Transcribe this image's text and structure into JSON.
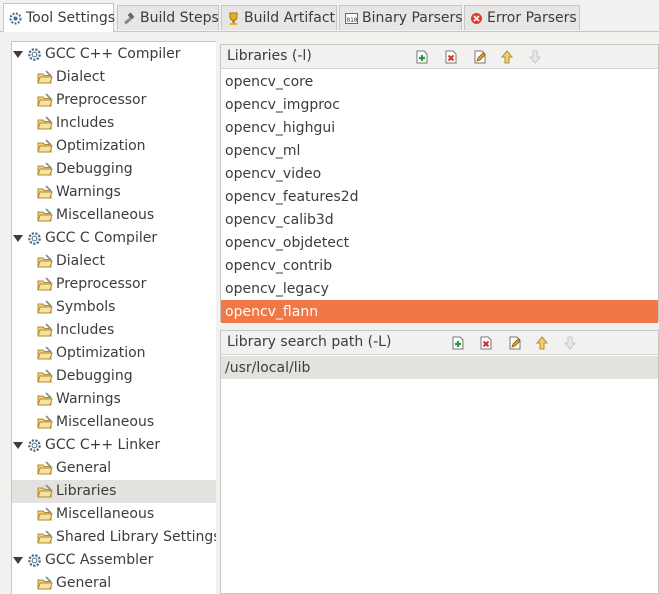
{
  "tabs": [
    {
      "label": "Tool Settings",
      "icon": "tool-settings-icon",
      "active": true
    },
    {
      "label": "Build Steps",
      "icon": "build-steps-icon",
      "active": false
    },
    {
      "label": "Build Artifact",
      "icon": "build-artifact-icon",
      "active": false
    },
    {
      "label": "Binary Parsers",
      "icon": "binary-parsers-icon",
      "active": false
    },
    {
      "label": "Error Parsers",
      "icon": "error-parsers-icon",
      "active": false
    }
  ],
  "tree": [
    {
      "label": "GCC C++ Compiler",
      "level": 0,
      "icon": "gear-icon"
    },
    {
      "label": "Dialect",
      "level": 1,
      "icon": "folder-icon"
    },
    {
      "label": "Preprocessor",
      "level": 1,
      "icon": "folder-icon"
    },
    {
      "label": "Includes",
      "level": 1,
      "icon": "folder-icon"
    },
    {
      "label": "Optimization",
      "level": 1,
      "icon": "folder-icon"
    },
    {
      "label": "Debugging",
      "level": 1,
      "icon": "folder-icon"
    },
    {
      "label": "Warnings",
      "level": 1,
      "icon": "folder-icon"
    },
    {
      "label": "Miscellaneous",
      "level": 1,
      "icon": "folder-icon"
    },
    {
      "label": "GCC C Compiler",
      "level": 0,
      "icon": "gear-icon"
    },
    {
      "label": "Dialect",
      "level": 1,
      "icon": "folder-icon"
    },
    {
      "label": "Preprocessor",
      "level": 1,
      "icon": "folder-icon"
    },
    {
      "label": "Symbols",
      "level": 1,
      "icon": "folder-icon"
    },
    {
      "label": "Includes",
      "level": 1,
      "icon": "folder-icon"
    },
    {
      "label": "Optimization",
      "level": 1,
      "icon": "folder-icon"
    },
    {
      "label": "Debugging",
      "level": 1,
      "icon": "folder-icon"
    },
    {
      "label": "Warnings",
      "level": 1,
      "icon": "folder-icon"
    },
    {
      "label": "Miscellaneous",
      "level": 1,
      "icon": "folder-icon"
    },
    {
      "label": "GCC C++ Linker",
      "level": 0,
      "icon": "gear-icon"
    },
    {
      "label": "General",
      "level": 1,
      "icon": "folder-icon"
    },
    {
      "label": "Libraries",
      "level": 1,
      "icon": "folder-icon",
      "selected": true
    },
    {
      "label": "Miscellaneous",
      "level": 1,
      "icon": "folder-icon"
    },
    {
      "label": "Shared Library Settings",
      "level": 1,
      "icon": "folder-icon"
    },
    {
      "label": "GCC Assembler",
      "level": 0,
      "icon": "gear-icon"
    },
    {
      "label": "General",
      "level": 1,
      "icon": "folder-icon"
    }
  ],
  "libraries": {
    "title": "Libraries (-l)",
    "toolbar": [
      "add-icon",
      "delete-icon",
      "edit-icon",
      "move-up-icon",
      "move-down-icon"
    ],
    "items": [
      "opencv_core",
      "opencv_imgproc",
      "opencv_highgui",
      "opencv_ml",
      "opencv_video",
      "opencv_features2d",
      "opencv_calib3d",
      "opencv_objdetect",
      "opencv_contrib",
      "opencv_legacy",
      "opencv_flann"
    ],
    "selected_index": 10
  },
  "library_paths": {
    "title": "Library search path (-L)",
    "toolbar": [
      "add-icon",
      "delete-icon",
      "edit-icon",
      "move-up-icon",
      "move-down-icon"
    ],
    "items": [
      "/usr/local/lib"
    ],
    "selected_index": 0
  },
  "colors": {
    "selection": "#f07746",
    "tree_selection": "#e4e2df",
    "background": "#f2f1f0"
  }
}
